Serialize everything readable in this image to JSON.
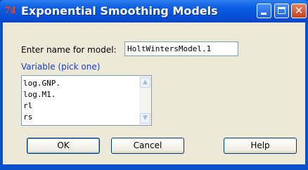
{
  "window": {
    "title": "Exponential Smoothing Models",
    "app_icon": "74"
  },
  "form": {
    "name_prompt": "Enter name for model:",
    "name_value": "HoltWintersModel.1",
    "variable_label": "Variable (pick one)",
    "variables": [
      "log.GNP.",
      "log.M1.",
      "rl",
      "rs"
    ]
  },
  "buttons": {
    "ok": "OK",
    "cancel": "Cancel",
    "help": "Help"
  },
  "icons": {
    "app": "tcl-tk-app-icon",
    "minimize": "minimize-icon",
    "maximize": "maximize-icon",
    "close": "close-icon",
    "scroll_up": "scroll-up-arrow-icon",
    "scroll_down": "scroll-down-arrow-icon"
  }
}
